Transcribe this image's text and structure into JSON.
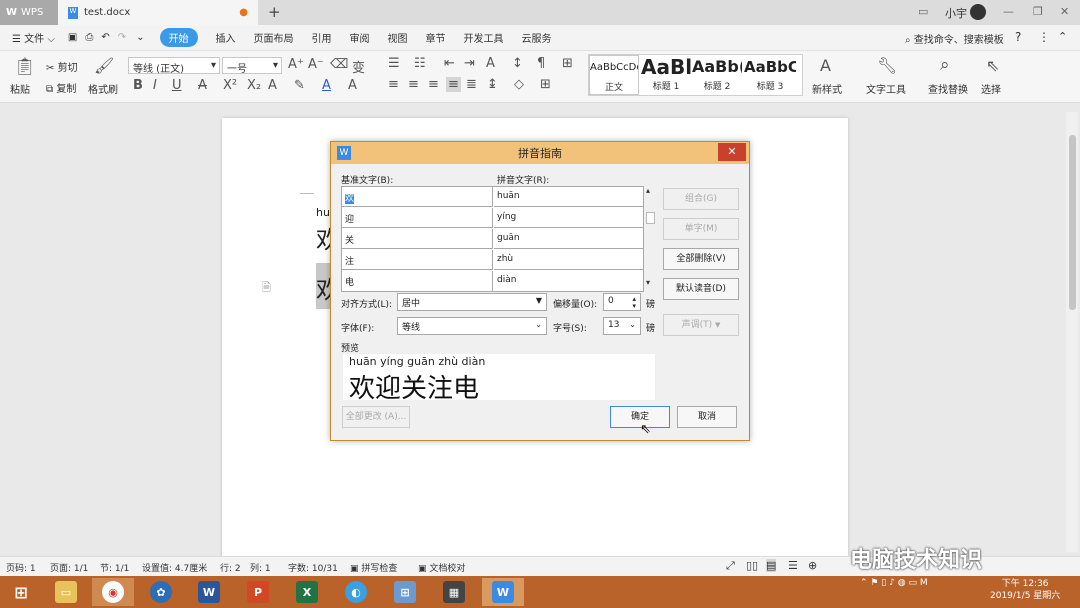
{
  "titlebar": {
    "app_tab": "WPS",
    "doc_tab": "test.docx",
    "user": "小宇"
  },
  "menu": {
    "file": "文件",
    "items": [
      "开始",
      "插入",
      "页面布局",
      "引用",
      "审阅",
      "视图",
      "章节",
      "开发工具",
      "云服务"
    ],
    "search": "查找命令、搜索模板"
  },
  "ribbon": {
    "paste": "粘贴",
    "cut": "剪切",
    "copy": "复制",
    "format_painter": "格式刷",
    "font_name": "等线 (正文)",
    "font_size": "一号",
    "styles": [
      {
        "preview": "AaBbCcDd",
        "label": "正文"
      },
      {
        "preview": "AaBl",
        "label": "标题 1"
      },
      {
        "preview": "AaBb(",
        "label": "标题 2"
      },
      {
        "preview": "AaBbC",
        "label": "标题 3"
      }
    ],
    "new_style": "新样式",
    "text_tools": "文字工具",
    "find_replace": "查找替换",
    "select": "选择"
  },
  "document": {
    "line1_pinyin": "hu",
    "line1_text": "欢",
    "line2_text": "欢"
  },
  "dialog": {
    "title": "拼音指南",
    "base_label": "基准文字(B):",
    "pinyin_label": "拼音文字(R):",
    "rows": [
      {
        "base": "欢",
        "pinyin": "huān"
      },
      {
        "base": "迎",
        "pinyin": "yíng"
      },
      {
        "base": "关",
        "pinyin": "guān"
      },
      {
        "base": "注",
        "pinyin": "zhù"
      },
      {
        "base": "电",
        "pinyin": "diàn"
      }
    ],
    "combine": "组合(G)",
    "single": "单字(M)",
    "delete_all": "全部删除(V)",
    "default_reading": "默认读音(D)",
    "tone": "声调(T)",
    "align_label": "对齐方式(L):",
    "align_value": "居中",
    "offset_label": "偏移量(O):",
    "offset_value": "0",
    "offset_unit": "磅",
    "font_label": "字体(F):",
    "font_value": "等线",
    "size_label": "字号(S):",
    "size_value": "13",
    "size_unit": "磅",
    "preview_label": "预览",
    "preview_pinyin": "huān yíng guān zhù diàn",
    "preview_text": "欢迎关注电",
    "change_all": "全部更改 (A)...",
    "ok": "确定",
    "cancel": "取消"
  },
  "status": {
    "page": "页码: 1",
    "pages": "页面: 1/1",
    "section": "节: 1/1",
    "setting": "设置值: 4.7厘米",
    "row": "行: 2",
    "col": "列: 1",
    "words": "字数: 10/31",
    "spell": "拼写检查",
    "proof": "文档校对"
  },
  "watermark": "电脑技术知识",
  "taskbar": {
    "time": "下午 12:36",
    "date": "2019/1/5 星期六"
  },
  "colors": {
    "accent": "#3b9ae8",
    "dialog_title": "#f2c27b",
    "taskbar": "#b9622a",
    "close": "#c9402c"
  }
}
